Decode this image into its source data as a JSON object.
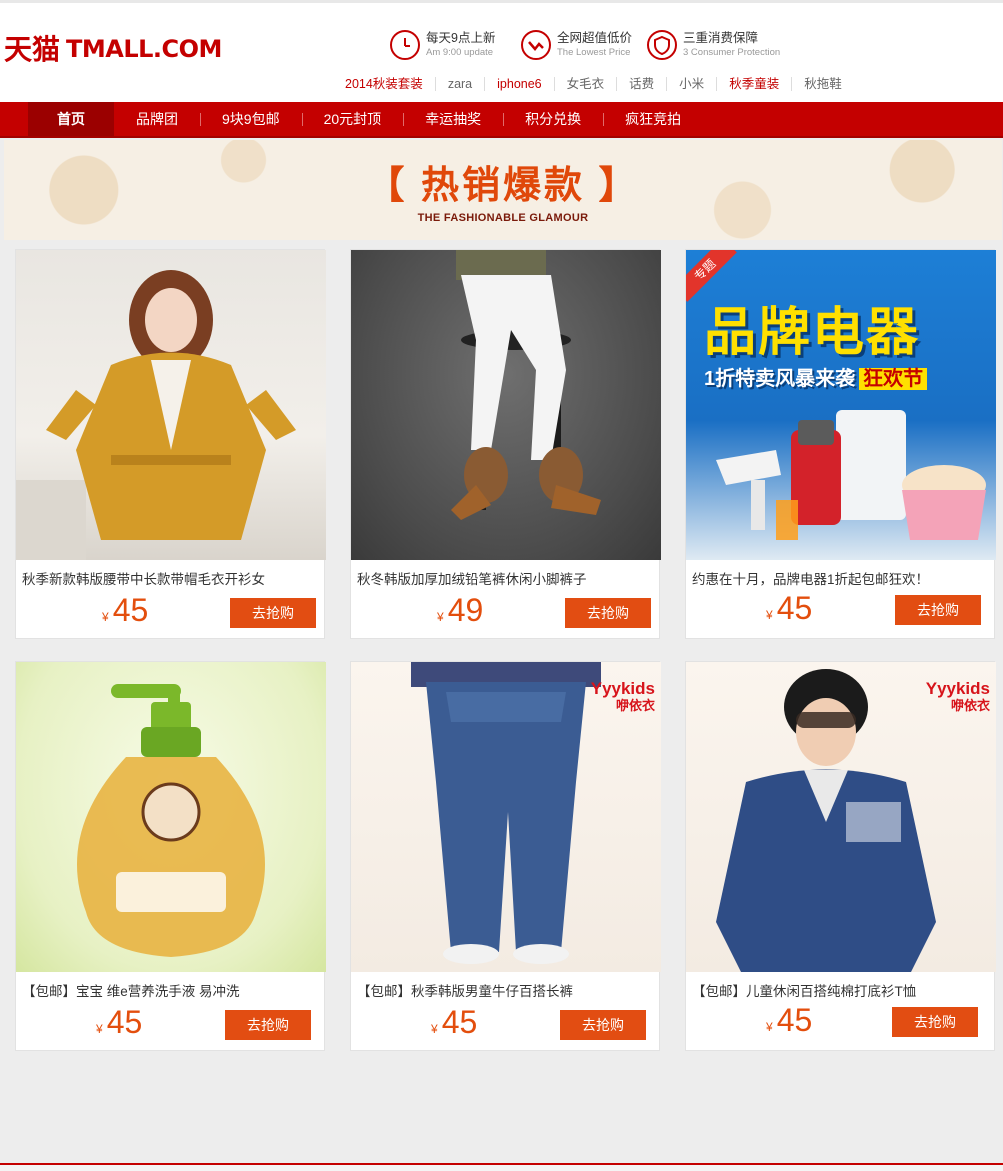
{
  "header": {
    "logo_cn": "天猫",
    "logo_en": "TMALL.COM",
    "promises": [
      {
        "title": "每天9点上新",
        "sub": "Am 9:00 update",
        "icon": "clock-icon"
      },
      {
        "title": "全网超值低价",
        "sub": "The Lowest Price",
        "icon": "price-down-icon"
      },
      {
        "title": "三重消费保障",
        "sub": "3 Consumer Protection",
        "icon": "shield-icon"
      }
    ],
    "hotwords": [
      "2014秋装套装",
      "zara",
      "iphone6",
      "女毛衣",
      "话费",
      "小米",
      "秋季童装",
      "秋拖鞋"
    ]
  },
  "nav": {
    "items": [
      "首页",
      "品牌团",
      "9块9包邮",
      "20元封顶",
      "幸运抽奖",
      "积分兑换",
      "疯狂竞拍"
    ],
    "active": "首页"
  },
  "banner": {
    "title": "【 热销爆款 】",
    "subtitle": "THE FASHIONABLE GLAMOUR"
  },
  "products": [
    {
      "title": "秋季新款韩版腰带中长款带帽毛衣开衫女",
      "currency": "¥",
      "price": "45",
      "buy": "去抢购"
    },
    {
      "title": "秋冬韩版加厚加绒铅笔裤休闲小脚裤子",
      "currency": "¥",
      "price": "49",
      "buy": "去抢购"
    },
    {
      "title": "约惠在十月，品牌电器1折起包邮狂欢！",
      "currency": "¥",
      "price": "45",
      "buy": "去抢购"
    },
    {
      "title": "【包邮】宝宝 维e营养洗手液 易冲洗",
      "currency": "¥",
      "price": "45",
      "buy": "去抢购"
    },
    {
      "title": "【包邮】秋季韩版男童牛仔百搭长裤",
      "currency": "¥",
      "price": "45",
      "buy": "去抢购"
    },
    {
      "title": "【包邮】儿童休闲百搭纯棉打底衫T恤",
      "currency": "¥",
      "price": "45",
      "buy": "去抢购"
    }
  ],
  "promo_art": {
    "ribbon": "专题",
    "headline": "品牌电器",
    "line2": "1折特卖风暴来袭",
    "line2_badge": "狂欢节"
  },
  "kids_brand": {
    "en": "Yyykids",
    "cn": "咿依衣"
  },
  "colors": {
    "brand_red": "#c40000",
    "price_orange": "#e34e0d",
    "button_orange": "#e24d12"
  }
}
